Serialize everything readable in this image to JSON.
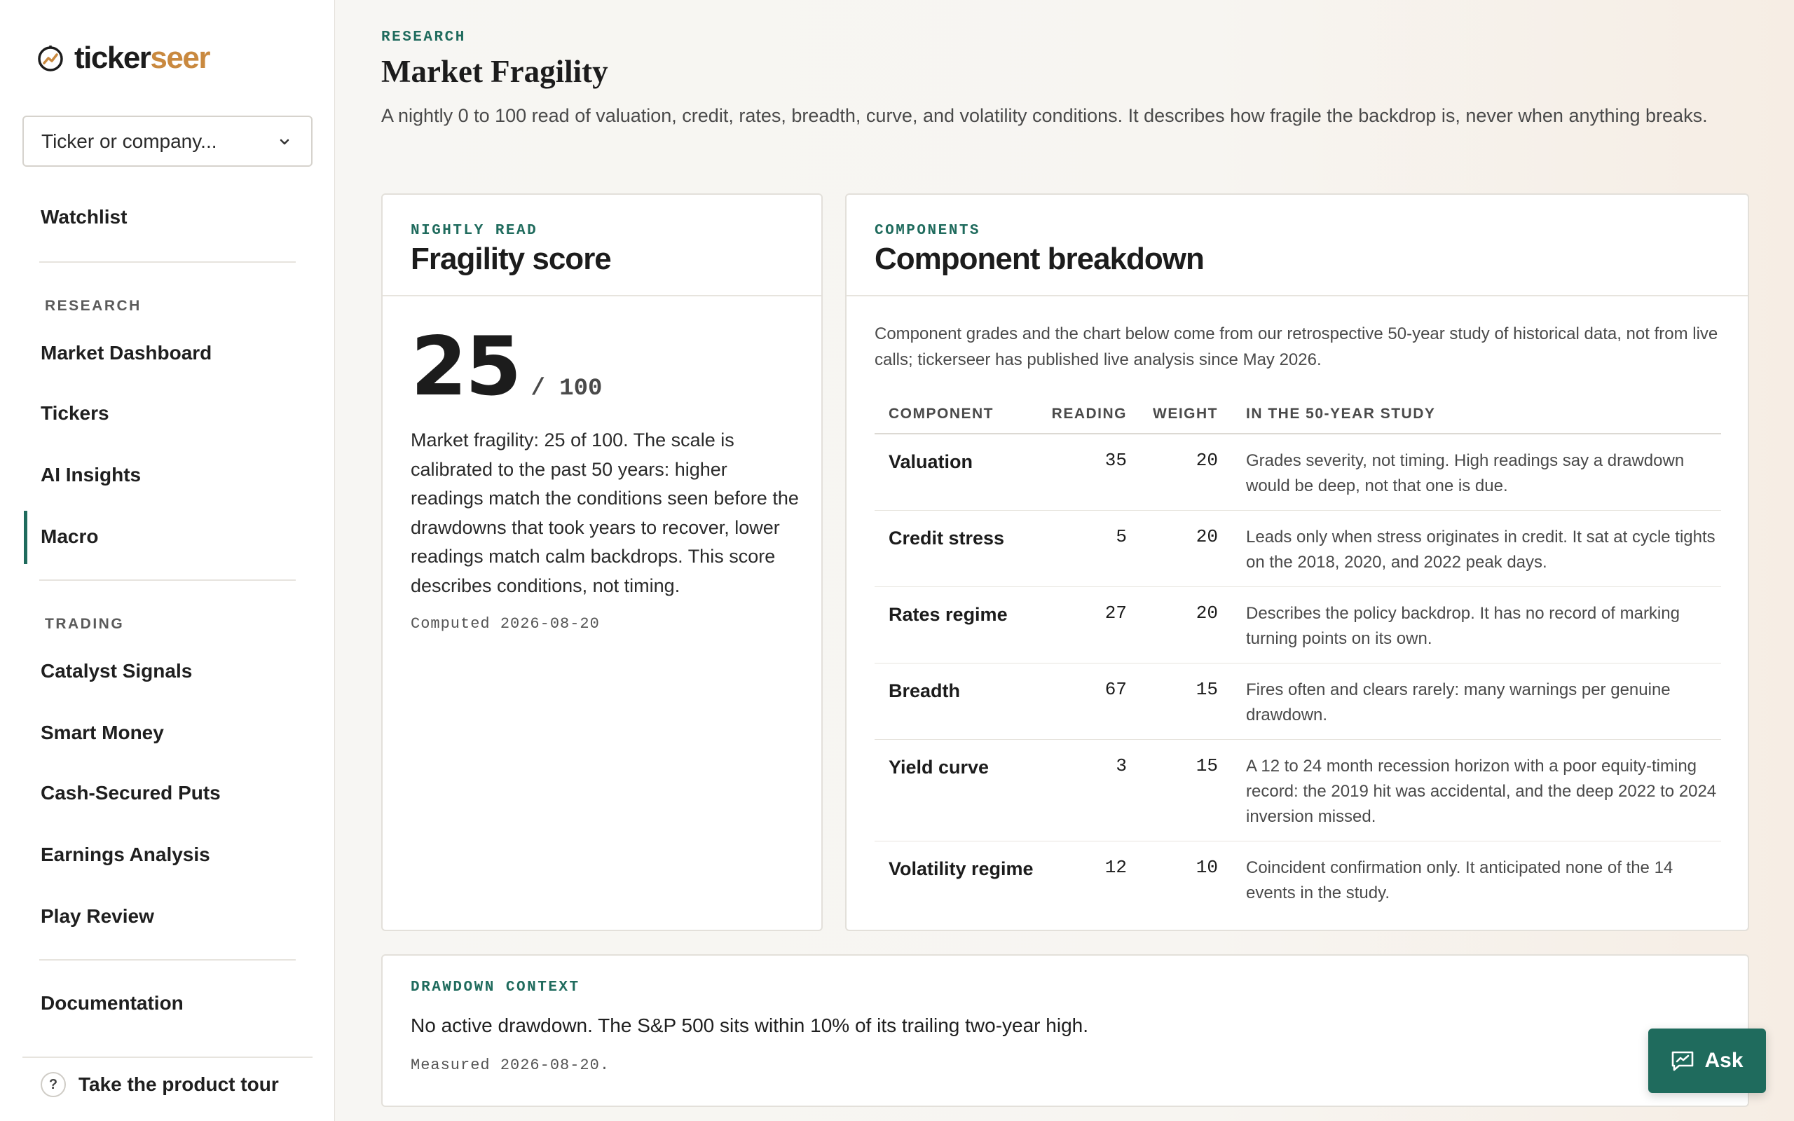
{
  "brand": {
    "part1": "ticker",
    "part2": "seer",
    "accent": "#c9893f"
  },
  "search": {
    "placeholder": "Ticker or company..."
  },
  "sidebar": {
    "top_items": [
      {
        "label": "Watchlist"
      }
    ],
    "research_label": "RESEARCH",
    "research_items": [
      {
        "label": "Market Dashboard"
      },
      {
        "label": "Tickers"
      },
      {
        "label": "AI Insights"
      },
      {
        "label": "Macro",
        "active": true
      }
    ],
    "trading_label": "TRADING",
    "trading_items": [
      {
        "label": "Catalyst Signals"
      },
      {
        "label": "Smart Money"
      },
      {
        "label": "Cash-Secured Puts"
      },
      {
        "label": "Earnings Analysis"
      },
      {
        "label": "Play Review"
      }
    ],
    "bottom_items": [
      {
        "label": "Documentation"
      }
    ],
    "tour": {
      "icon": "?",
      "label": "Take the product tour"
    }
  },
  "header": {
    "eyebrow": "RESEARCH",
    "title": "Market Fragility",
    "description": "A nightly 0 to 100 read of valuation, credit, rates, breadth, curve, and volatility conditions. It describes how fragile the backdrop is, never when anything breaks."
  },
  "fragility": {
    "eyebrow": "NIGHTLY READ",
    "title": "Fragility score",
    "score": "25",
    "max": "/ 100",
    "explanation": "Market fragility: 25 of 100. The scale is calibrated to the past 50 years: higher readings match the conditions seen before the drawdowns that took years to recover, lower readings match calm backdrops. This score describes conditions, not timing.",
    "computed": "Computed 2026-08-20"
  },
  "components": {
    "eyebrow": "COMPONENTS",
    "title": "Component breakdown",
    "note": "Component grades and the chart below come from our retrospective 50-year study of historical data, not from live calls; tickerseer has published live analysis since May 2026.",
    "columns": [
      "COMPONENT",
      "READING",
      "WEIGHT",
      "IN THE 50-YEAR STUDY"
    ],
    "rows": [
      {
        "name": "Valuation",
        "reading": "35",
        "weight": "20",
        "study": "Grades severity, not timing. High readings say a drawdown would be deep, not that one is due."
      },
      {
        "name": "Credit stress",
        "reading": "5",
        "weight": "20",
        "study": "Leads only when stress originates in credit. It sat at cycle tights on the 2018, 2020, and 2022 peak days."
      },
      {
        "name": "Rates regime",
        "reading": "27",
        "weight": "20",
        "study": "Describes the policy backdrop. It has no record of marking turning points on its own."
      },
      {
        "name": "Breadth",
        "reading": "67",
        "weight": "15",
        "study": "Fires often and clears rarely: many warnings per genuine drawdown."
      },
      {
        "name": "Yield curve",
        "reading": "3",
        "weight": "15",
        "study": "A 12 to 24 month recession horizon with a poor equity-timing record: the 2019 hit was accidental, and the deep 2022 to 2024 inversion missed."
      },
      {
        "name": "Volatility regime",
        "reading": "12",
        "weight": "10",
        "study": "Coincident confirmation only. It anticipated none of the 14 events in the study."
      }
    ]
  },
  "drawdown": {
    "eyebrow": "DRAWDOWN CONTEXT",
    "text": "No active drawdown. The S&P 500 sits within 10% of its trailing two-year high.",
    "measured": "Measured 2026-08-20."
  },
  "ask": {
    "label": "Ask"
  },
  "colors": {
    "accent": "#1f6b5d"
  }
}
